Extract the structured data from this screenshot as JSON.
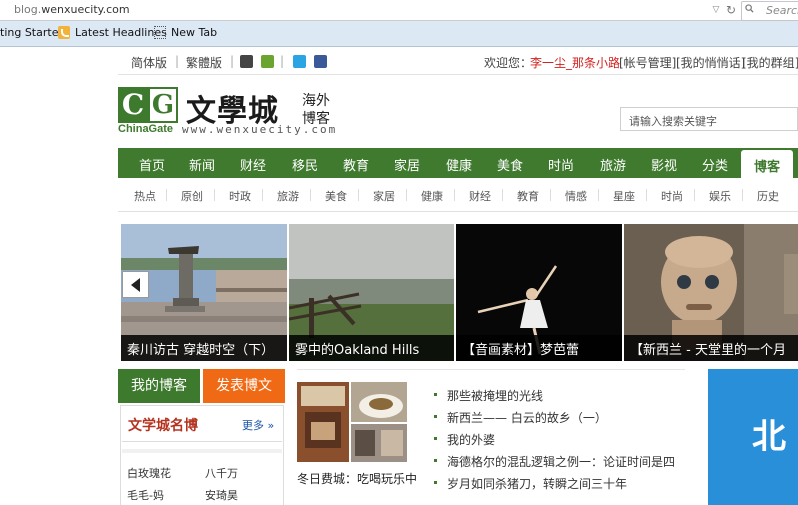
{
  "browser": {
    "url_host": "blog.",
    "url_domain": "wenxuecity.com",
    "search_placeholder": "Search",
    "bookmarks": [
      "ting Started",
      "Latest Headlines",
      "New Tab"
    ]
  },
  "topbar": {
    "lang_simple": "简体版",
    "lang_traditional": "繁體版",
    "welcome_prefix": "欢迎您：",
    "user_name": "李一尘_那条小路",
    "account_links": [
      "[帐号管理]",
      "[我的悄悄话]",
      "[我的群组]"
    ],
    "icon_colors": {
      "apple": "#444444",
      "android": "#6ba52f",
      "twitter": "#2aa4e3",
      "facebook": "#3b5998"
    }
  },
  "logo": {
    "cg_letters": [
      "C",
      "G"
    ],
    "cg_name": "ChinaGate",
    "site_name": "文學城",
    "sub1": "海外",
    "sub2": "博客",
    "site_url": "www.wenxuecity.com"
  },
  "site_search": {
    "placeholder": "请输入搜索关键字"
  },
  "nav": {
    "items": [
      "首页",
      "新闻",
      "财经",
      "移民",
      "教育",
      "家居",
      "健康",
      "美食",
      "时尚",
      "旅游",
      "影视",
      "分类"
    ],
    "active": "博客",
    "bg_color": "#3f7a2f"
  },
  "subnav": {
    "items": [
      "热点",
      "原创",
      "时政",
      "旅游",
      "美食",
      "家居",
      "健康",
      "财经",
      "教育",
      "情感",
      "星座",
      "时尚",
      "娱乐",
      "历史"
    ]
  },
  "slides": [
    {
      "caption": "秦川访古 穿越时空（下）"
    },
    {
      "caption": "雾中的Oakland Hills"
    },
    {
      "caption": "【音画素材】梦芭蕾"
    },
    {
      "caption": "【新西兰 - 天堂里的一个月"
    }
  ],
  "sidebar": {
    "my_blog": "我的博客",
    "post": "发表博文",
    "famous_title": "文学城名博",
    "more": "更多 »",
    "names": [
      "白玫瑰花",
      "八千万",
      "毛毛-妈",
      "安琦昊"
    ]
  },
  "featured": {
    "caption": "冬日费城：吃喝玩乐中"
  },
  "articles": [
    "那些被掩埋的光线",
    "新西兰—— 白云的故乡（一）",
    "我的外婆",
    "海德格尔的混乱逻辑之例一：论证时间是四",
    "岁月如同杀猪刀，转瞬之间三十年"
  ],
  "ad": {
    "text": "北"
  }
}
